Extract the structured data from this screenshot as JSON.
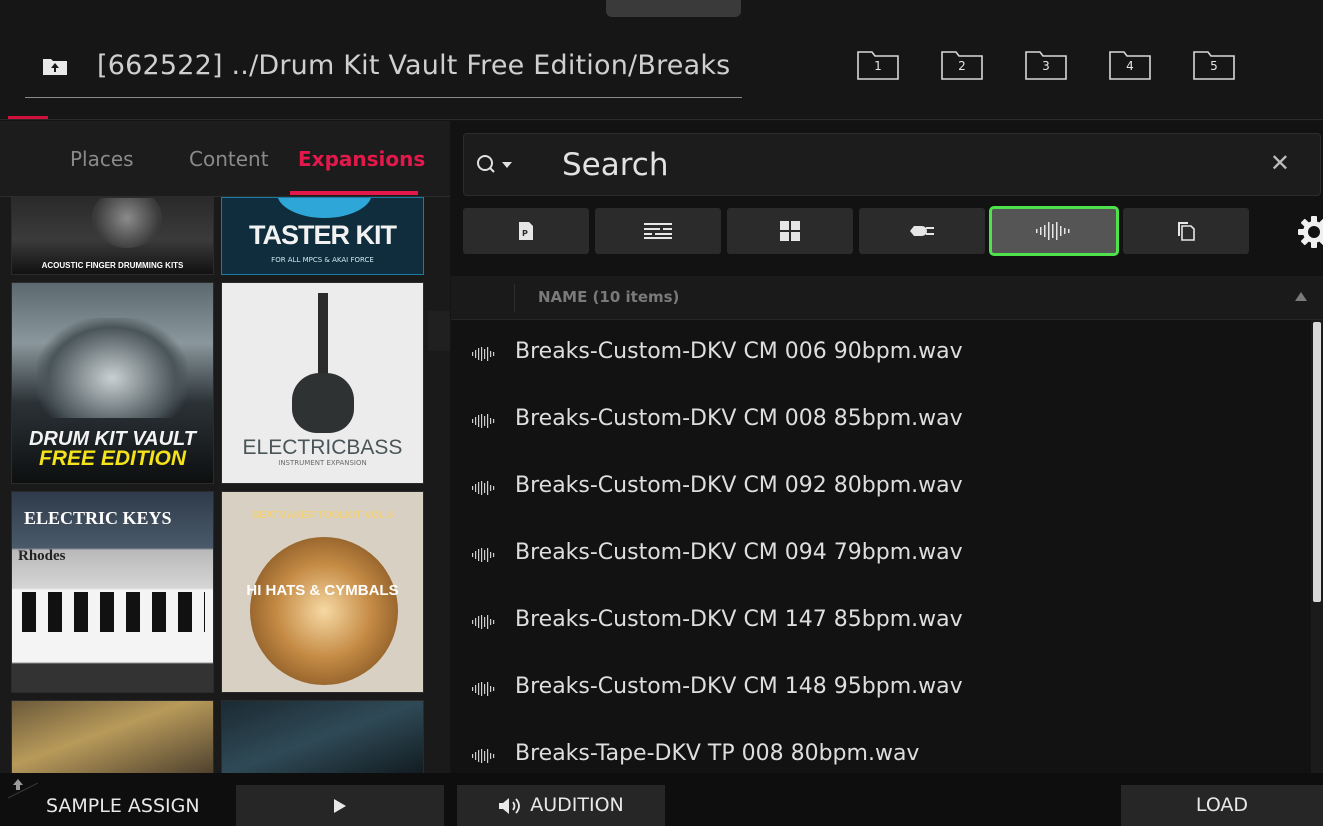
{
  "header": {
    "path": "[662522] ../Drum Kit Vault Free Edition/Breaks",
    "shortcuts": [
      "1",
      "2",
      "3",
      "4",
      "5"
    ]
  },
  "left_pane": {
    "tabs": [
      {
        "label": "Places",
        "active": false
      },
      {
        "label": "Content",
        "active": false
      },
      {
        "label": "Expansions",
        "active": true
      }
    ],
    "expansions": [
      {
        "title": "ACOUSTIC FINGER DRUMMING KITS"
      },
      {
        "title": "TASTER KIT",
        "subtitle": "FOR ALL MPCS & AKAI FORCE"
      },
      {
        "title": "DRUM KIT VAULT",
        "subtitle": "FREE EDITION"
      },
      {
        "title": "ELECTRICBASS",
        "subtitle": "INSTRUMENT EXPANSION"
      },
      {
        "title": "ELECTRIC KEYS",
        "subtitle": "Rhodes"
      },
      {
        "title": "HI HATS & CYMBALS",
        "subtitle": "BEATMAKER TOOLKIT VOL 3"
      },
      {
        "title": ""
      },
      {
        "title": ""
      }
    ]
  },
  "search": {
    "placeholder": "Search",
    "clear_icon": "close-icon"
  },
  "filters": [
    {
      "name": "program-filter",
      "icon": "program-icon",
      "active": false
    },
    {
      "name": "sequence-filter",
      "icon": "sequence-icon",
      "active": false
    },
    {
      "name": "kit-filter",
      "icon": "grid-icon",
      "active": false
    },
    {
      "name": "plugin-filter",
      "icon": "plug-icon",
      "active": false
    },
    {
      "name": "sample-filter",
      "icon": "waveform-icon",
      "active": true
    },
    {
      "name": "project-filter",
      "icon": "copy-icon",
      "active": false
    }
  ],
  "file_list": {
    "header": "NAME (10 items)",
    "items": [
      "Breaks-Custom-DKV CM 006 90bpm.wav",
      "Breaks-Custom-DKV CM 008 85bpm.wav",
      "Breaks-Custom-DKV CM 092 80bpm.wav",
      "Breaks-Custom-DKV CM 094 79bpm.wav",
      "Breaks-Custom-DKV CM 147 85bpm.wav",
      "Breaks-Custom-DKV CM 148 95bpm.wav",
      "Breaks-Tape-DKV TP 008 80bpm.wav"
    ]
  },
  "bottom": {
    "sample_assign": "SAMPLE ASSIGN",
    "play_icon": "play-icon",
    "audition": "AUDITION",
    "load": "LOAD"
  },
  "colors": {
    "accent": "#e5184c",
    "active_outline": "#4ee34b"
  }
}
